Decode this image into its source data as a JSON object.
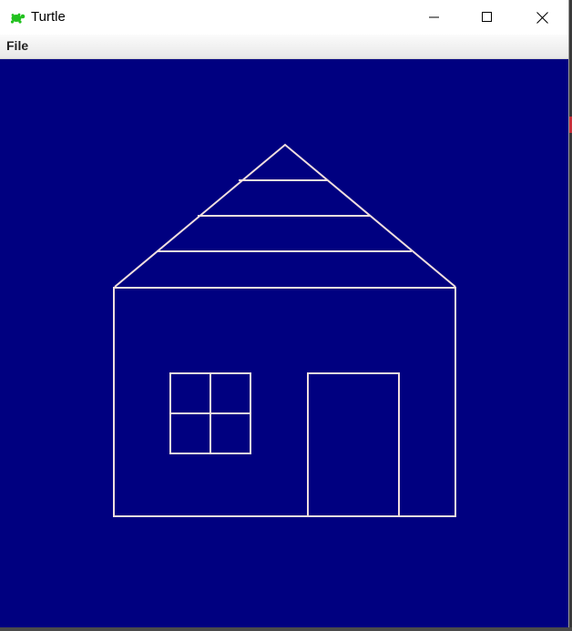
{
  "window": {
    "title": "Turtle",
    "icon": "turtle-icon",
    "controls": {
      "minimize_icon": "minimize-icon",
      "maximize_icon": "maximize-icon",
      "close_icon": "close-icon"
    }
  },
  "menubar": {
    "items": [
      {
        "label": "File"
      }
    ]
  },
  "canvas": {
    "background_color": "#000080",
    "pen_color": "#f0dede",
    "drawing_subject": "house"
  },
  "colors": {
    "turtle_icon": "#22c11f"
  }
}
